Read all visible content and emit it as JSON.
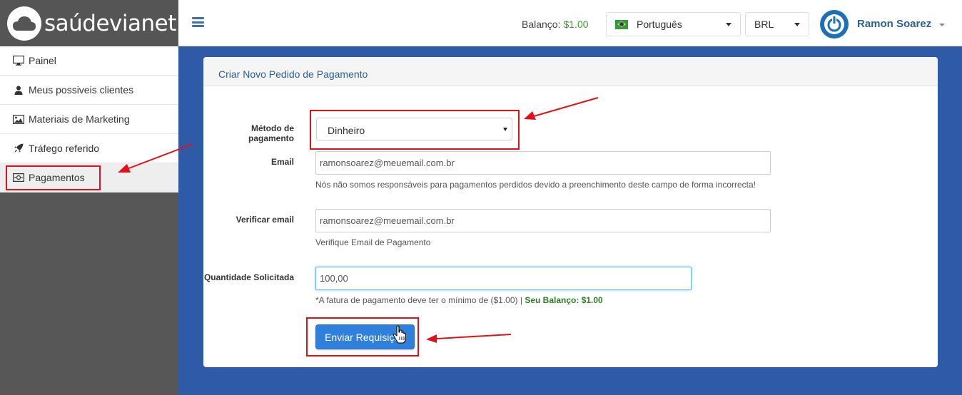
{
  "brand": {
    "logo_text": "saúdevianet"
  },
  "header": {
    "balance_label": "Balanço:",
    "balance_value": "$1.00",
    "language": "Português",
    "currency": "BRL",
    "user_name": "Ramon Soarez"
  },
  "sidebar": {
    "items": [
      {
        "label": "Painel",
        "icon": "monitor-icon"
      },
      {
        "label": "Meus possiveis clientes",
        "icon": "user-icon"
      },
      {
        "label": "Materiais de Marketing",
        "icon": "image-icon"
      },
      {
        "label": "Tráfego referido",
        "icon": "rocket-icon"
      },
      {
        "label": "Pagamentos",
        "icon": "money-icon",
        "active": true
      }
    ]
  },
  "form": {
    "title": "Criar Novo Pedido de Pagamento",
    "method_label": "Método de pagamento",
    "method_value": "Dinheiro",
    "email_label": "Email",
    "email_value": "ramonsoarez@meuemail.com.br",
    "email_help": "Nós não somos responsáveis para pagamentos perdidos devido a preenchimento deste campo de forma incorrecta!",
    "verify_label": "Verificar email",
    "verify_value": "ramonsoarez@meuemail.com.br",
    "verify_help": "Verifique Email de Pagamento",
    "amount_label": "Quantidade Solicitada",
    "amount_value": "100,00",
    "amount_help": "*A fatura de pagamento deve ter o mínimo de ($1.00) |",
    "amount_help_balance": "Seu Balanço: $1.00",
    "submit_label": "Enviar Requisição"
  },
  "colors": {
    "accent": "#2f80dc",
    "sidebar_bg": "#575757",
    "content_bg": "#2f5aa8",
    "annotation": "#e0111b",
    "balance_green": "#3c9a29"
  }
}
